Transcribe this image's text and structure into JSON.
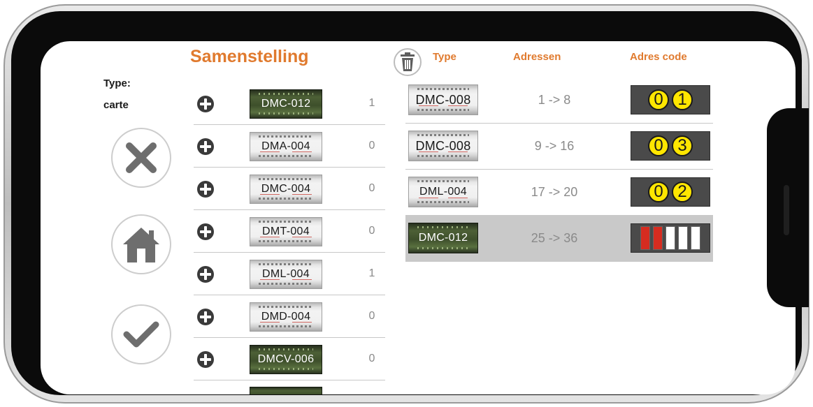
{
  "left": {
    "type_label": "Type:",
    "carte_label": "carte",
    "buttons": [
      {
        "name": "cancel-button",
        "icon": "close-icon"
      },
      {
        "name": "home-button",
        "icon": "home-icon"
      },
      {
        "name": "confirm-button",
        "icon": "check-icon"
      }
    ]
  },
  "composition": {
    "title": "Samenstelling",
    "items": [
      {
        "label": "DMC-012",
        "count": "1",
        "style": "green"
      },
      {
        "label": "DMA-004",
        "count": "0",
        "style": "gray"
      },
      {
        "label": "DMC-004",
        "count": "0",
        "style": "gray"
      },
      {
        "label": "DMT-004",
        "count": "0",
        "style": "gray"
      },
      {
        "label": "DML-004",
        "count": "1",
        "style": "gray"
      },
      {
        "label": "DMD-004",
        "count": "0",
        "style": "gray"
      },
      {
        "label": "DMCV-006",
        "count": "0",
        "style": "green"
      }
    ]
  },
  "table": {
    "headers": {
      "type": "Type",
      "addresses": "Adressen",
      "code": "Adres code"
    },
    "rows": [
      {
        "type": "DMC-008",
        "range": "1 -> 8",
        "code": [
          "0",
          "1"
        ],
        "style": "gray",
        "selected": false
      },
      {
        "type": "DMC-008",
        "range": "9 -> 16",
        "code": [
          "0",
          "3"
        ],
        "style": "gray",
        "selected": false
      },
      {
        "type": "DML-004",
        "range": "17 -> 20",
        "code": [
          "0",
          "2"
        ],
        "style": "gray",
        "selected": false
      },
      {
        "type": "DMC-012",
        "range": "25 -> 36",
        "code_bars": [
          true,
          true,
          false,
          false,
          false
        ],
        "style": "green",
        "selected": true
      }
    ]
  },
  "colors": {
    "accent": "#e07a2e",
    "code_digit": "#ffe600",
    "bar_on": "#d62c20"
  }
}
